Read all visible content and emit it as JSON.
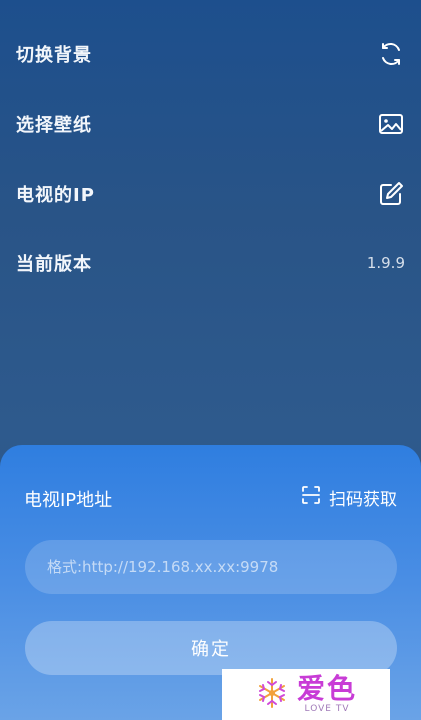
{
  "settings": {
    "items": [
      {
        "label": "切换背景",
        "icon": "refresh-icon"
      },
      {
        "label": "选择壁纸",
        "icon": "image-icon"
      },
      {
        "label": "电视的IP",
        "icon": "edit-icon"
      },
      {
        "label": "当前版本",
        "value": "1.9.9"
      }
    ]
  },
  "dialog": {
    "title": "电视IP地址",
    "scan_label": "扫码获取",
    "scan_icon": "scan-icon",
    "input_placeholder": "格式:http://192.168.xx.xx:9978",
    "input_value": "",
    "confirm_label": "确定"
  },
  "watermark": {
    "main": "爱色",
    "sub": "LOVE TV"
  },
  "colors": {
    "sheet_blue": "#2f7ee0",
    "background_top": "#1d4f8d",
    "watermark_magenta": "#c83cd6"
  }
}
